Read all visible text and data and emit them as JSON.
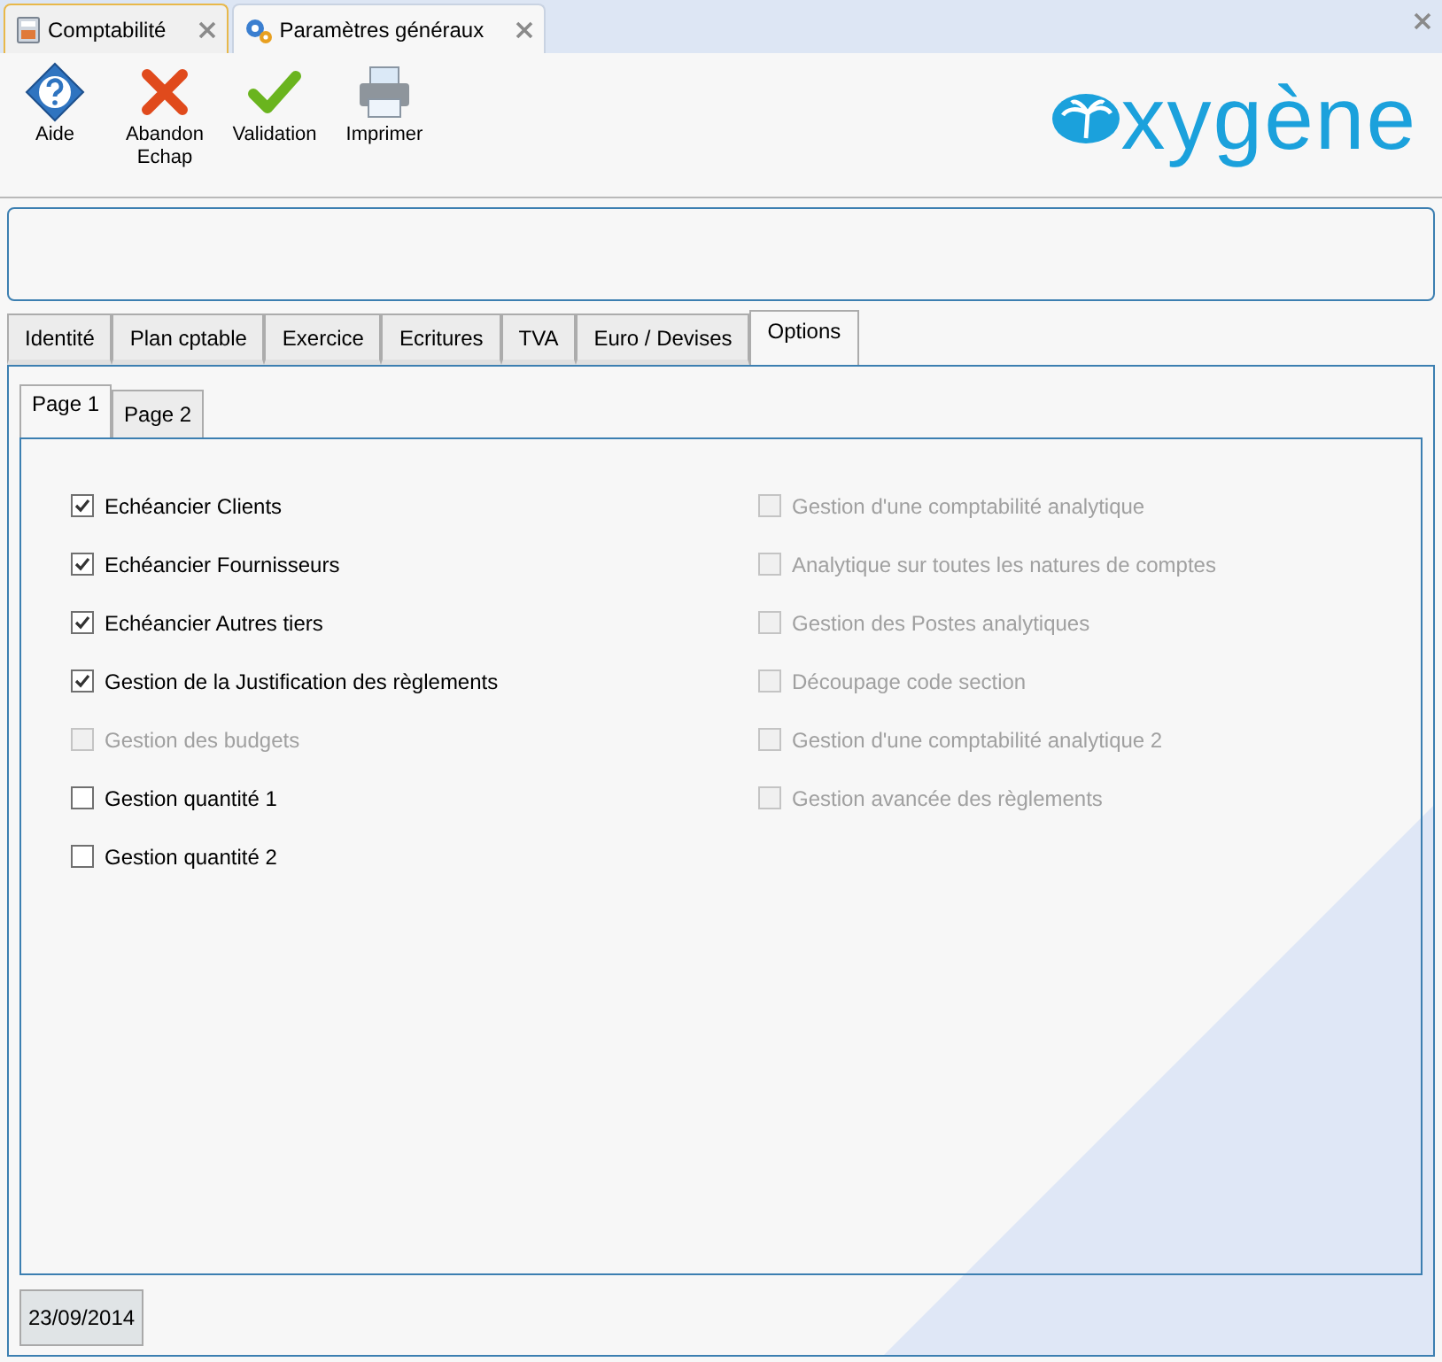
{
  "window_tabs": [
    {
      "label": "Comptabilité",
      "selected": false,
      "kind": "calculator"
    },
    {
      "label": "Paramètres généraux",
      "selected": true,
      "kind": "gears"
    }
  ],
  "toolbar": [
    {
      "label": "Aide",
      "kind": "help"
    },
    {
      "label": "Abandon\nEchap",
      "kind": "cancel"
    },
    {
      "label": "Validation",
      "kind": "check"
    },
    {
      "label": "Imprimer",
      "kind": "print"
    }
  ],
  "logo": {
    "text": "xygène"
  },
  "tabs": [
    {
      "label": "Identité",
      "selected": false
    },
    {
      "label": "Plan cptable",
      "selected": false
    },
    {
      "label": "Exercice",
      "selected": false
    },
    {
      "label": "Ecritures",
      "selected": false
    },
    {
      "label": "TVA",
      "selected": false
    },
    {
      "label": "Euro / Devises",
      "selected": false
    },
    {
      "label": "Options",
      "selected": true
    }
  ],
  "subtabs": [
    {
      "label": "Page 1",
      "selected": true
    },
    {
      "label": "Page 2",
      "selected": false
    }
  ],
  "left_options": [
    {
      "label": "Echéancier Clients",
      "checked": true,
      "disabled": false
    },
    {
      "label": "Echéancier Fournisseurs",
      "checked": true,
      "disabled": false
    },
    {
      "label": "Echéancier Autres tiers",
      "checked": true,
      "disabled": false
    },
    {
      "label": "Gestion de la Justification des règlements",
      "checked": true,
      "disabled": false
    },
    {
      "label": "Gestion des budgets",
      "checked": false,
      "disabled": true
    },
    {
      "label": "Gestion quantité 1",
      "checked": false,
      "disabled": false
    },
    {
      "label": "Gestion quantité 2",
      "checked": false,
      "disabled": false
    }
  ],
  "right_options": [
    {
      "label": "Gestion d'une comptabilité analytique",
      "checked": false,
      "disabled": true
    },
    {
      "label": "Analytique sur toutes les natures de comptes",
      "checked": false,
      "disabled": true
    },
    {
      "label": "Gestion des Postes analytiques",
      "checked": false,
      "disabled": true
    },
    {
      "label": "Découpage code section",
      "checked": false,
      "disabled": true
    },
    {
      "label": "Gestion d'une comptabilité analytique 2",
      "checked": false,
      "disabled": true
    },
    {
      "label": "Gestion avancée des règlements",
      "checked": false,
      "disabled": true
    }
  ],
  "status_date": "23/09/2014"
}
